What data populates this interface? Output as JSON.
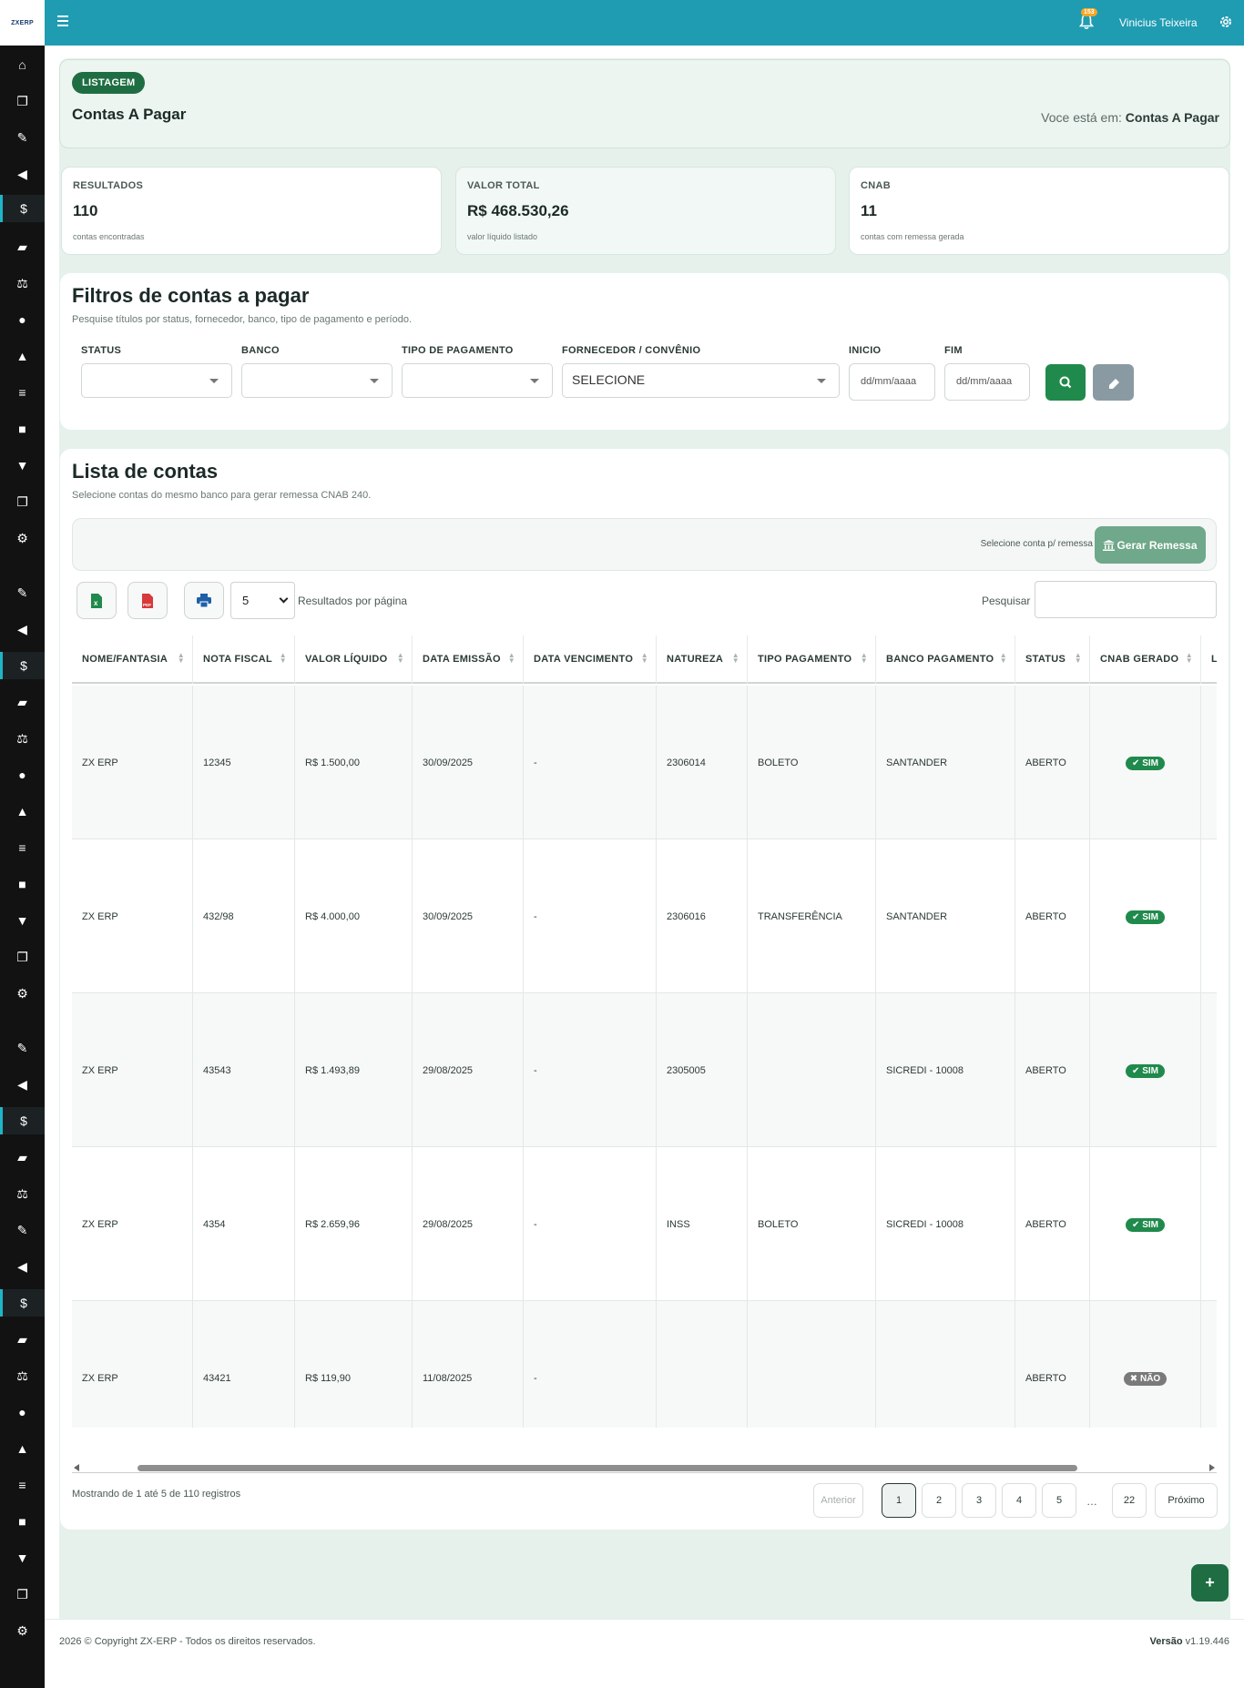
{
  "app": {
    "logo_text": "ZXERP",
    "colors": {
      "topbar": "#1f9cb2",
      "sidebar": "#121212",
      "primary": "#1f6e43",
      "success": "#1f8a4c"
    }
  },
  "topbar": {
    "notification_count": "153",
    "username": "Vinicius Teixeira"
  },
  "sidebar": {
    "icons": [
      "home-icon",
      "files-icon",
      "edit-icon",
      "megaphone-icon",
      "dollar-icon",
      "book-icon",
      "scale-icon",
      "globe-icon",
      "warning-icon",
      "list-icon",
      "lock-icon",
      "graduation-icon",
      "files-icon",
      "gear-icon",
      "edit-icon",
      "megaphone-icon",
      "dollar-icon",
      "book-icon",
      "scale-icon",
      "globe-icon",
      "warning-icon",
      "list-icon",
      "lock-icon",
      "graduation-icon",
      "files-icon",
      "gear-icon",
      "edit-icon",
      "megaphone-icon",
      "dollar-icon",
      "book-icon",
      "scale-icon",
      "edit-icon",
      "megaphone-icon",
      "dollar-icon",
      "book-icon",
      "scale-icon",
      "globe-icon",
      "warning-icon",
      "list-icon",
      "lock-icon",
      "graduation-icon",
      "files-icon",
      "gear-icon"
    ],
    "active_item": "dollar-icon"
  },
  "header": {
    "pill": "LISTAGEM",
    "title": "Contas A Pagar",
    "breadcrumb_prefix": "Voce está em: ",
    "breadcrumb_current": "Contas A Pagar"
  },
  "stats": [
    {
      "label": "RESULTADOS",
      "value": "110",
      "sub": "contas encontradas"
    },
    {
      "label": "VALOR TOTAL",
      "value": "R$ 468.530,26",
      "sub": "valor líquido listado"
    },
    {
      "label": "CNAB",
      "value": "11",
      "sub": "contas com remessa gerada"
    }
  ],
  "filters": {
    "title": "Filtros de contas a pagar",
    "subtitle": "Pesquise títulos por status, fornecedor, banco, tipo de pagamento e período.",
    "status_label": "STATUS",
    "banco_label": "BANCO",
    "tipo_label": "TIPO DE PAGAMENTO",
    "fornecedor_label": "FORNECEDOR / CONVÊNIO",
    "fornecedor_value": "SELECIONE",
    "inicio_label": "INICIO",
    "fim_label": "FIM",
    "date_placeholder": "dd/mm/aaaa"
  },
  "list": {
    "title": "Lista de contas",
    "subtitle": "Selecione contas do mesmo banco para gerar remessa CNAB 240.",
    "remessa_hint": "Selecione conta p/ remessa",
    "gerar_label": "Gerar Remessa",
    "per_page": "5",
    "per_page_label": "Resultados por página",
    "search_label": "Pesquisar",
    "columns": [
      "NOME/FANTASIA",
      "NOTA FISCAL",
      "VALOR LÍQUIDO",
      "DATA EMISSÃO",
      "DATA VENCIMENTO",
      "NATUREZA",
      "TIPO PAGAMENTO",
      "BANCO PAGAMENTO",
      "STATUS",
      "CNAB GERADO",
      "L"
    ],
    "rows": [
      {
        "nome": "ZX ERP",
        "nf": "12345",
        "valor": "R$ 1.500,00",
        "emissao": "30/09/2025",
        "vencimento": "-",
        "natureza": "2306014",
        "tipo": "BOLETO",
        "banco": "SANTANDER",
        "status": "ABERTO",
        "cnab": "SIM"
      },
      {
        "nome": "ZX ERP",
        "nf": "432/98",
        "valor": "R$ 4.000,00",
        "emissao": "30/09/2025",
        "vencimento": "-",
        "natureza": "2306016",
        "tipo": "TRANSFERÊNCIA",
        "banco": "SANTANDER",
        "status": "ABERTO",
        "cnab": "SIM"
      },
      {
        "nome": "ZX ERP",
        "nf": "43543",
        "valor": "R$ 1.493,89",
        "emissao": "29/08/2025",
        "vencimento": "-",
        "natureza": "2305005",
        "tipo": "",
        "banco": "SICREDI - 10008",
        "status": "ABERTO",
        "cnab": "SIM"
      },
      {
        "nome": "ZX ERP",
        "nf": "4354",
        "valor": "R$ 2.659,96",
        "emissao": "29/08/2025",
        "vencimento": "-",
        "natureza": "INSS",
        "tipo": "BOLETO",
        "banco": "SICREDI - 10008",
        "status": "ABERTO",
        "cnab": "SIM"
      },
      {
        "nome": "ZX ERP",
        "nf": "43421",
        "valor": "R$ 119,90",
        "emissao": "11/08/2025",
        "vencimento": "-",
        "natureza": "",
        "tipo": "",
        "banco": "",
        "status": "ABERTO",
        "cnab": "NÃO"
      }
    ],
    "showing": "Mostrando de 1 até 5 de 110 registros",
    "pagination": {
      "prev": "Anterior",
      "pages": [
        "1",
        "2",
        "3",
        "4",
        "5"
      ],
      "ellipsis": "…",
      "last": "22",
      "next": "Próximo",
      "current": "1"
    }
  },
  "footer": {
    "copyright": "2026 © Copyright ZX-ERP - Todos os direitos reservados.",
    "version_label": "Versão",
    "version": "v1.19.446"
  }
}
